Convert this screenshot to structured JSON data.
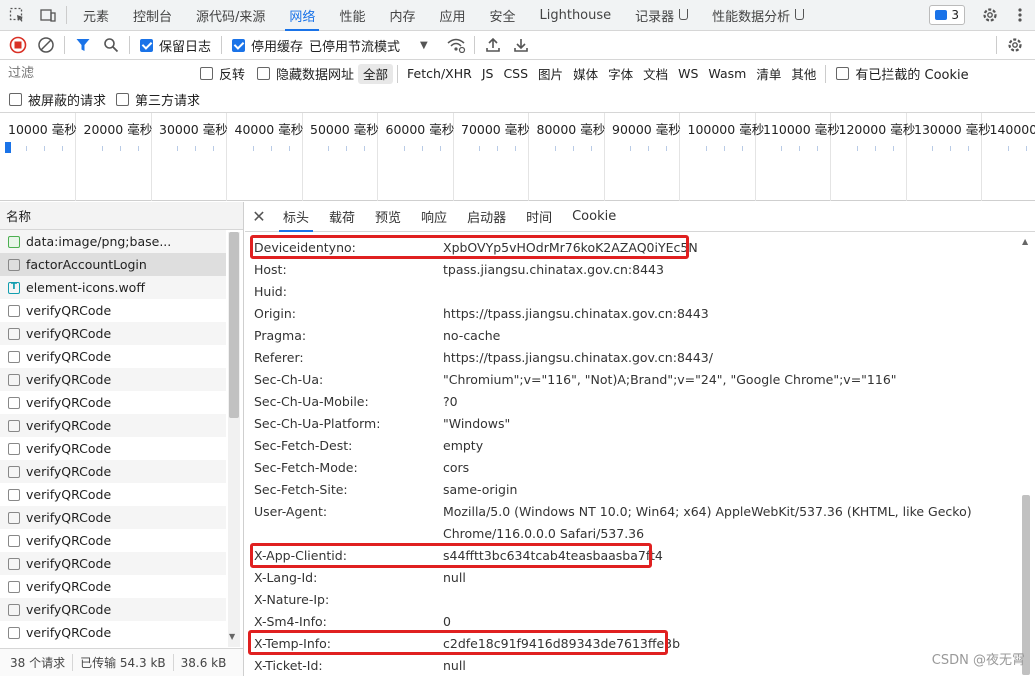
{
  "devtools_tabs": [
    "元素",
    "控制台",
    "源代码/来源",
    "网络",
    "性能",
    "内存",
    "应用",
    "安全",
    "Lighthouse",
    "记录器",
    "性能数据分析"
  ],
  "active_tab": "网络",
  "issues_count": "3",
  "toolbar": {
    "preserve_log": "保留日志",
    "disable_cache": "停用缓存",
    "throttling": "已停用节流模式"
  },
  "filter": {
    "placeholder": "过滤",
    "invert": "反转",
    "hide_data_urls": "隐藏数据网址",
    "types": [
      "全部",
      "Fetch/XHR",
      "JS",
      "CSS",
      "图片",
      "媒体",
      "字体",
      "文档",
      "WS",
      "Wasm",
      "清单",
      "其他"
    ],
    "blocked_cookies": "有已拦截的 Cookie",
    "blocked_requests": "被屏蔽的请求",
    "third_party": "第三方请求"
  },
  "timeline_ticks": [
    "10000 毫秒",
    "20000 毫秒",
    "30000 毫秒",
    "40000 毫秒",
    "50000 毫秒",
    "60000 毫秒",
    "70000 毫秒",
    "80000 毫秒",
    "90000 毫秒",
    "100000 毫秒",
    "110000 毫秒",
    "120000 毫秒",
    "130000 毫秒",
    "140000 毫"
  ],
  "request_list": {
    "header": "名称",
    "rows": [
      {
        "name": "data:image/png;base...",
        "type": "img"
      },
      {
        "name": "factorAccountLogin",
        "type": "doc"
      },
      {
        "name": "element-icons.woff",
        "type": "font"
      },
      {
        "name": "verifyQRCode",
        "type": "doc"
      },
      {
        "name": "verifyQRCode",
        "type": "doc"
      },
      {
        "name": "verifyQRCode",
        "type": "doc"
      },
      {
        "name": "verifyQRCode",
        "type": "doc"
      },
      {
        "name": "verifyQRCode",
        "type": "doc"
      },
      {
        "name": "verifyQRCode",
        "type": "doc"
      },
      {
        "name": "verifyQRCode",
        "type": "doc"
      },
      {
        "name": "verifyQRCode",
        "type": "doc"
      },
      {
        "name": "verifyQRCode",
        "type": "doc"
      },
      {
        "name": "verifyQRCode",
        "type": "doc"
      },
      {
        "name": "verifyQRCode",
        "type": "doc"
      },
      {
        "name": "verifyQRCode",
        "type": "doc"
      },
      {
        "name": "verifyQRCode",
        "type": "doc"
      },
      {
        "name": "verifyQRCode",
        "type": "doc"
      },
      {
        "name": "verifyQRCode",
        "type": "doc"
      }
    ]
  },
  "status_bar": {
    "requests": "38 个请求",
    "transferred": "已传输 54.3 kB",
    "resources": "38.6 kB"
  },
  "detail_tabs": [
    "标头",
    "载荷",
    "预览",
    "响应",
    "启动器",
    "时间",
    "Cookie"
  ],
  "headers": [
    {
      "k": "Deviceidentyno:",
      "v": "XpbOVYp5vHOdrMr76koK2AZAQ0iYEc5N"
    },
    {
      "k": "Host:",
      "v": "tpass.jiangsu.chinatax.gov.cn:8443"
    },
    {
      "k": "Huid:",
      "v": ""
    },
    {
      "k": "Origin:",
      "v": "https://tpass.jiangsu.chinatax.gov.cn:8443"
    },
    {
      "k": "Pragma:",
      "v": "no-cache"
    },
    {
      "k": "Referer:",
      "v": "https://tpass.jiangsu.chinatax.gov.cn:8443/"
    },
    {
      "k": "Sec-Ch-Ua:",
      "v": "\"Chromium\";v=\"116\", \"Not)A;Brand\";v=\"24\", \"Google Chrome\";v=\"116\""
    },
    {
      "k": "Sec-Ch-Ua-Mobile:",
      "v": "?0"
    },
    {
      "k": "Sec-Ch-Ua-Platform:",
      "v": "\"Windows\""
    },
    {
      "k": "Sec-Fetch-Dest:",
      "v": "empty"
    },
    {
      "k": "Sec-Fetch-Mode:",
      "v": "cors"
    },
    {
      "k": "Sec-Fetch-Site:",
      "v": "same-origin"
    },
    {
      "k": "User-Agent:",
      "v": "Mozilla/5.0 (Windows NT 10.0; Win64; x64) AppleWebKit/537.36 (KHTML, like Gecko)"
    },
    {
      "k": "",
      "v": "Chrome/116.0.0.0 Safari/537.36"
    },
    {
      "k": "X-App-Clientid:",
      "v": "s44fftt3bc634tcab4teasbaasba7ft4"
    },
    {
      "k": "X-Lang-Id:",
      "v": "null"
    },
    {
      "k": "X-Nature-Ip:",
      "v": ""
    },
    {
      "k": "X-Sm4-Info:",
      "v": "0"
    },
    {
      "k": "X-Temp-Info:",
      "v": "c2dfe18c91f9416d89343de7613ffe3b"
    },
    {
      "k": "X-Ticket-Id:",
      "v": "null"
    }
  ],
  "watermark": "CSDN @夜无霄",
  "colors": {
    "accent": "#1a73e8",
    "highlight": "#e02020",
    "record": "#d93025"
  }
}
